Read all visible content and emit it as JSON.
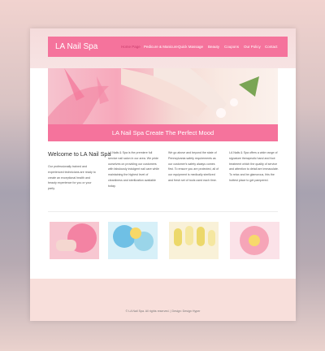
{
  "site": {
    "logo": "LA Nail Spa"
  },
  "nav": {
    "items": [
      {
        "label": "Home Page",
        "active": true
      },
      {
        "label": "Pedicure & Manicure",
        "active": false
      },
      {
        "label": "Quick Massage",
        "active": false
      },
      {
        "label": "Beauty",
        "active": false
      },
      {
        "label": "Coupons",
        "active": false
      },
      {
        "label": "Our Policy",
        "active": false
      },
      {
        "label": "Contact",
        "active": false
      }
    ]
  },
  "hero": {
    "tagline": "LA Nail Spa Create The Perfect Mood"
  },
  "content": {
    "welcome_title": "Welcome to LA Nail Spa",
    "col1": "Our professionally trained and experienced technicians are ready to create an exceptional health and beauty experience for you or your party.",
    "col2": "LA Nails & Spa is the premiere full service nail salon in our area. We pride ourselves on providing our customers with fabulously indulgent nail care while maintaining the highest level of cleanliness and sterilization available today.",
    "col3": "We go above and beyond the state of Pennsylvania safety requirements as our customer's safety always comes first. To ensure you are protected, all of our equipment is medically sterilized and fresh set of tools used each time.",
    "col4": "LA Nails & Spa offers a wide range of signature therapeutic hand and foot treatment which the quality of service and attention to detail are immaculate. To relax and be glamorous, this the hottest place to get pampered."
  },
  "gallery": {
    "images": [
      {
        "name": "pink-nails-flower",
        "color": "#f7b6c4"
      },
      {
        "name": "blue-floral-nails",
        "color": "#7fc7e4"
      },
      {
        "name": "yellow-pattern-nails",
        "color": "#f0e4a2"
      },
      {
        "name": "pink-flower-closeup",
        "color": "#f6a8b9"
      }
    ]
  },
  "footer": {
    "text": "© LA Nail Spa. All rights reserved. | Design: Design Hyper"
  },
  "colors": {
    "accent": "#f5739c",
    "hero_active_nav": "#c83c6b",
    "footer_bg": "#f8dfdb",
    "header_bg": "#f5dcdc"
  }
}
